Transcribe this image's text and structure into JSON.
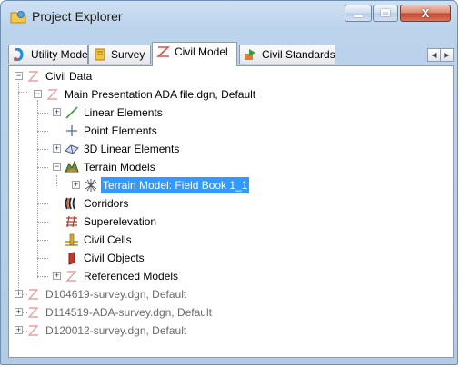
{
  "window": {
    "title": "Project Explorer"
  },
  "tabs": [
    {
      "label": "Utility Model",
      "icon": "utility-model-icon"
    },
    {
      "label": "Survey",
      "icon": "survey-icon"
    },
    {
      "label": "Civil Model",
      "icon": "civil-model-icon",
      "active": true
    },
    {
      "label": "Civil Standards",
      "icon": "civil-standards-icon"
    }
  ],
  "tree": {
    "root": {
      "label": "Civil Data",
      "expanded": true
    },
    "main_file": {
      "label": "Main Presentation ADA file.dgn, Default",
      "expanded": true
    },
    "children": [
      {
        "label": "Linear Elements",
        "icon": "linear-elements-icon",
        "expander": "+"
      },
      {
        "label": "Point Elements",
        "icon": "point-elements-icon",
        "expander": ""
      },
      {
        "label": "3D Linear Elements",
        "icon": "3d-linear-elements-icon",
        "expander": "+"
      },
      {
        "label": "Terrain Models",
        "icon": "terrain-models-icon",
        "expander": "-"
      },
      {
        "label": "Corridors",
        "icon": "corridors-icon",
        "expander": ""
      },
      {
        "label": "Superelevation",
        "icon": "superelevation-icon",
        "expander": ""
      },
      {
        "label": "Civil Cells",
        "icon": "civil-cells-icon",
        "expander": ""
      },
      {
        "label": "Civil Objects",
        "icon": "civil-objects-icon",
        "expander": ""
      },
      {
        "label": "Referenced Models",
        "icon": "referenced-models-icon",
        "expander": "+"
      }
    ],
    "terrain_child": {
      "label": "Terrain Model: Field Book 1_1",
      "selected": true
    },
    "other_files": [
      {
        "label": "D104619-survey.dgn, Default"
      },
      {
        "label": "D114519-ADA-survey.dgn, Default"
      },
      {
        "label": "D120012-survey.dgn, Default"
      }
    ]
  },
  "colors": {
    "selection": "#3399ff",
    "frame": "#b3cbe6",
    "close": "#c6452b"
  }
}
